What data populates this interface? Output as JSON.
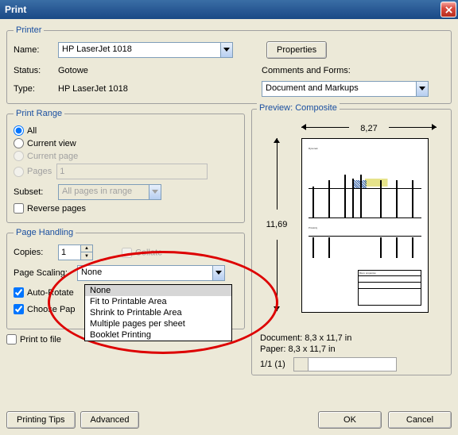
{
  "window": {
    "title": "Print"
  },
  "printer": {
    "legend": "Printer",
    "name_label": "Name:",
    "name_value": "HP LaserJet 1018",
    "status_label": "Status:",
    "status_value": "Gotowe",
    "type_label": "Type:",
    "type_value": "HP LaserJet 1018",
    "properties_btn": "Properties",
    "comments_label": "Comments and Forms:",
    "comments_value": "Document and Markups"
  },
  "range": {
    "legend": "Print Range",
    "all": "All",
    "current_view": "Current view",
    "current_page": "Current page",
    "pages": "Pages",
    "pages_value": "1",
    "subset_label": "Subset:",
    "subset_value": "All pages in range",
    "reverse": "Reverse pages"
  },
  "handling": {
    "legend": "Page Handling",
    "copies_label": "Copies:",
    "copies_value": "1",
    "collate": "Collate",
    "scaling_label": "Page Scaling:",
    "scaling_value": "None",
    "scaling_options": [
      "None",
      "Fit to Printable Area",
      "Shrink to Printable Area",
      "Multiple pages per sheet",
      "Booklet Printing"
    ],
    "auto_rotate": "Auto-Rotate",
    "choose_paper": "Choose Pap"
  },
  "print_to_file": "Print to file",
  "preview": {
    "legend": "Preview: Composite",
    "width": "8,27",
    "height": "11,69",
    "doc_label": "Document: 8,3 x 11,7 in",
    "paper_label": "Paper: 8,3 x 11,7 in",
    "page_indicator": "1/1 (1)"
  },
  "buttons": {
    "tips": "Printing Tips",
    "advanced": "Advanced",
    "ok": "OK",
    "cancel": "Cancel"
  }
}
